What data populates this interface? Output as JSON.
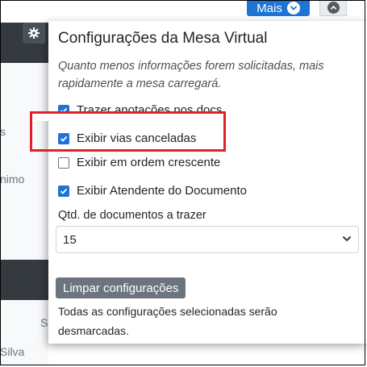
{
  "top_bar": {
    "more_button_label": "Mais",
    "more_icon": "chevron-down-icon",
    "collapse_icon": "chevron-up-icon"
  },
  "background": {
    "fragments": [
      "s",
      "nimo",
      "S",
      "Silva"
    ]
  },
  "panel": {
    "gear_icon": "gear-icon",
    "title": "Configurações da Mesa Virtual",
    "subtitle": "Quanto menos informações forem solicitadas, mais rapidamente a mesa carregará.",
    "options": [
      {
        "label": "Trazer anotações nos docs.",
        "checked": true
      },
      {
        "label": "Exibir vias canceladas",
        "checked": true
      },
      {
        "label": "Exibir em ordem crescente",
        "checked": false
      },
      {
        "label": "Exibir Atendente do Documento",
        "checked": true
      }
    ],
    "quantity_label": "Qtd. de documentos a trazer",
    "quantity_value": "15",
    "clear_button_label": "Limpar configurações",
    "clear_note": "Todas as configurações selecionadas serão desmarcadas."
  },
  "colors": {
    "accent": "#1e73d6",
    "highlight": "#e0202a",
    "secondary_button": "#6c757d"
  }
}
